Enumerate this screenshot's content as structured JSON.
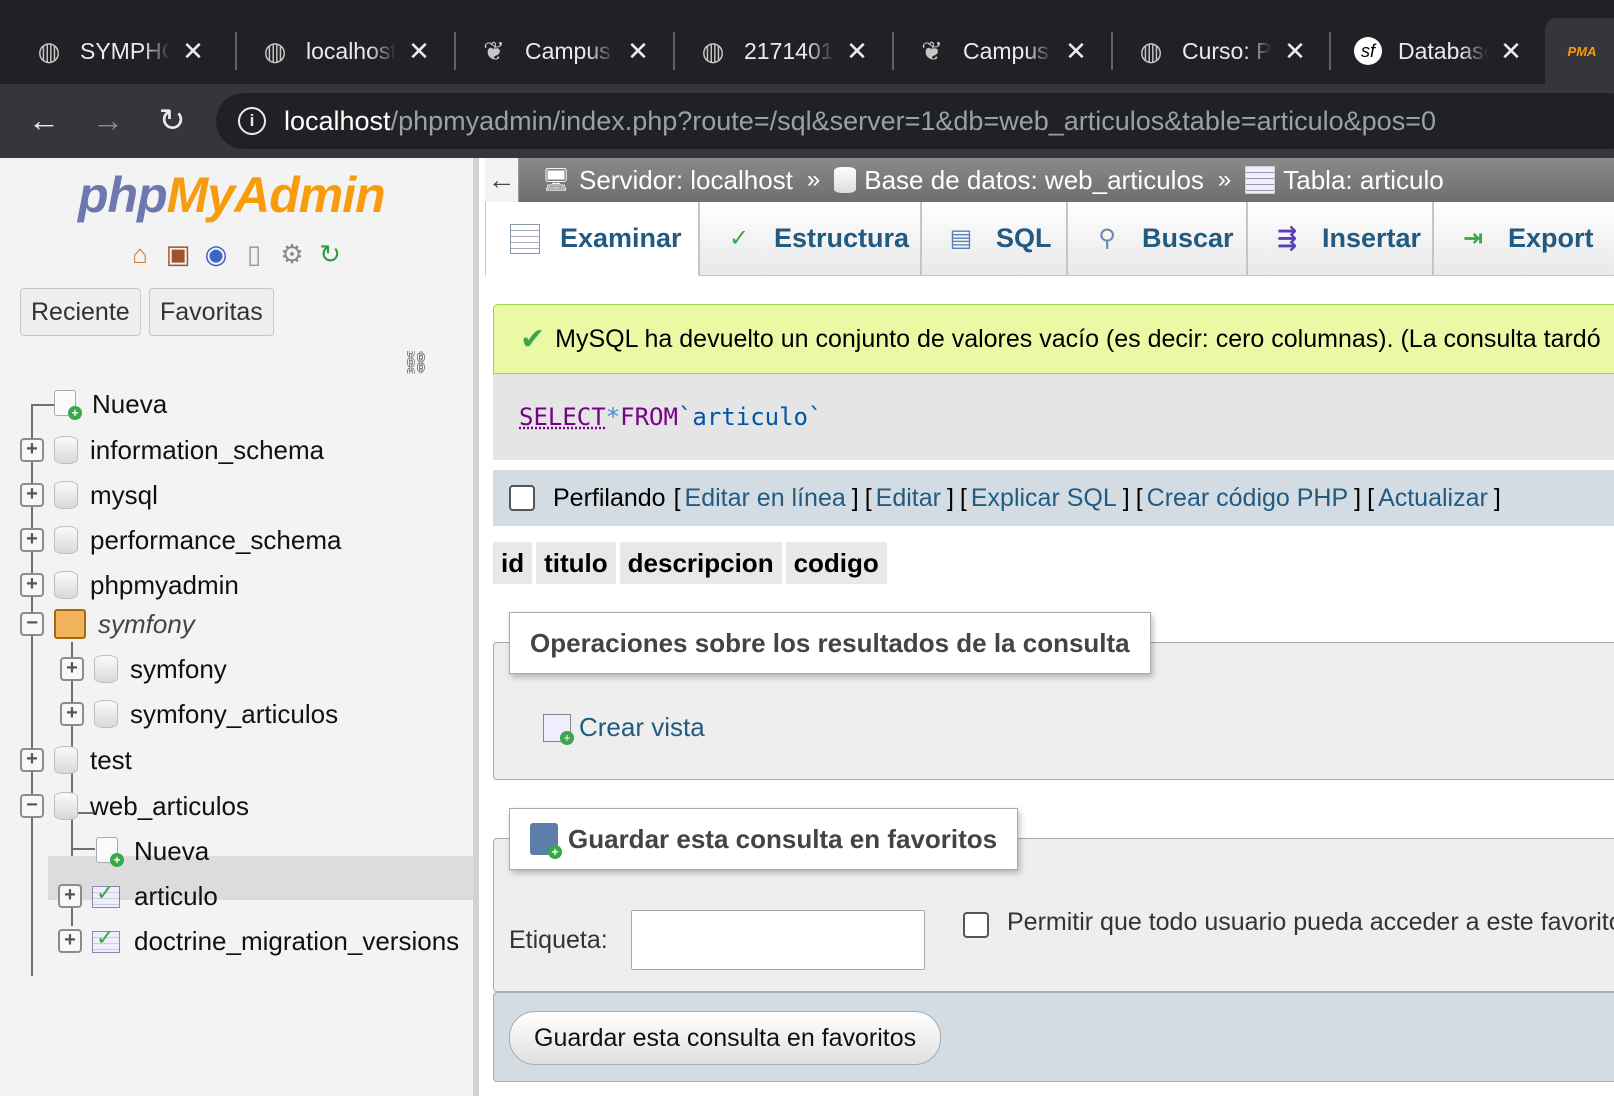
{
  "browser": {
    "tabs": [
      {
        "title": "SYMPHONY",
        "icon": "globe-icon"
      },
      {
        "title": "localhost",
        "icon": "globe-icon"
      },
      {
        "title": "Campus",
        "icon": "campus-icon"
      },
      {
        "title": "2171401",
        "icon": "globe-icon"
      },
      {
        "title": "Campus",
        "icon": "campus-icon"
      },
      {
        "title": "Curso: P",
        "icon": "globe-icon"
      },
      {
        "title": "Database",
        "icon": "symfony-icon"
      }
    ],
    "tab_close": "✕",
    "pinned_tab_icon": "PMA",
    "url_host": "localhost",
    "url_path": "/phpmyadmin/index.php?route=/sql&server=1&db=web_articulos&table=articulo&pos=0",
    "nav": {
      "back": "←",
      "forward": "→",
      "reload": "↻",
      "info": "i"
    }
  },
  "sidebar": {
    "logo": {
      "php": "php",
      "my": "My",
      "admin": "Admin"
    },
    "recent_label": "Reciente",
    "favorites_label": "Favoritas",
    "tree": {
      "new": "Nueva",
      "information_schema": "information_schema",
      "mysql": "mysql",
      "performance_schema": "performance_schema",
      "phpmyadmin": "phpmyadmin",
      "symfony_group": "symfony",
      "symfony": "symfony",
      "symfony_articulos": "symfony_articulos",
      "test": "test",
      "web_articulos": "web_articulos",
      "web_new": "Nueva",
      "articulo": "articulo",
      "doctrine": "doctrine_migration_versions"
    }
  },
  "breadcrumb": {
    "collapse": "←",
    "server": "Servidor: localhost",
    "database": "Base de datos: web_articulos",
    "table": "Tabla: articulo",
    "sep": "»"
  },
  "tabs": {
    "browse": "Examinar",
    "structure": "Estructura",
    "sql": "SQL",
    "search": "Buscar",
    "insert": "Insertar",
    "export": "Export"
  },
  "message": {
    "success": "MySQL ha devuelto un conjunto de valores vacío (es decir: cero columnas). (La consulta tardó",
    "check": "✔"
  },
  "query": {
    "select": "SELECT",
    "star": "*",
    "from": "FROM",
    "table": "`articulo`"
  },
  "profiling": {
    "label": "Perfilando",
    "open": "[",
    "close": "]",
    "links": [
      "Editar en línea",
      "Editar",
      "Explicar SQL",
      "Crear código PHP",
      "Actualizar"
    ]
  },
  "result_columns": [
    "id",
    "titulo",
    "descripcion",
    "codigo"
  ],
  "operations": {
    "legend": "Operaciones sobre los resultados de la consulta",
    "create_view": "Crear vista"
  },
  "bookmark": {
    "legend": "Guardar esta consulta en favoritos",
    "label_field": "Etiqueta:",
    "label_value": "",
    "shared_label": "Permitir que todo usuario pueda acceder a este favorito",
    "submit": "Guardar esta consulta en favoritos"
  },
  "colors": {
    "link": "#235a81",
    "success_bg": "#ebf8a4",
    "chrome_dark": "#202124"
  }
}
